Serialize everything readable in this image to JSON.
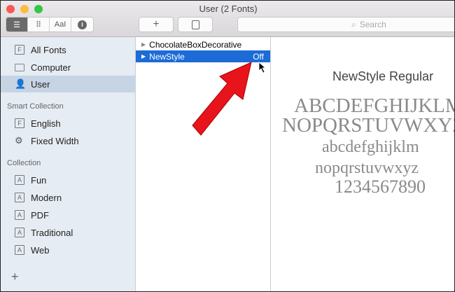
{
  "window": {
    "title": "User (2 Fonts)"
  },
  "toolbar": {
    "view_list": "list-view",
    "view_grid": "grid-view",
    "view_sample": "AaI",
    "info": "i",
    "add": "+",
    "search_placeholder": "Search"
  },
  "sidebar": {
    "items": [
      {
        "label": "All Fonts",
        "icon": "F"
      },
      {
        "label": "Computer"
      },
      {
        "label": "User"
      }
    ],
    "smart_header": "Smart Collection",
    "smart": [
      {
        "label": "English",
        "icon": "F"
      },
      {
        "label": "Fixed Width"
      }
    ],
    "collection_header": "Collection",
    "collections": [
      {
        "label": "Fun",
        "icon": "A"
      },
      {
        "label": "Modern",
        "icon": "A"
      },
      {
        "label": "PDF",
        "icon": "A"
      },
      {
        "label": "Traditional",
        "icon": "A"
      },
      {
        "label": "Web",
        "icon": "A"
      }
    ],
    "add": "+"
  },
  "fonts": [
    {
      "name": "ChocolateBoxDecorative",
      "status": ""
    },
    {
      "name": "NewStyle",
      "status": "Off"
    }
  ],
  "preview": {
    "title": "NewStyle Regular",
    "lines": [
      "ABCDEFGHIJKLM",
      "NOPQRSTUVWXYZ",
      "abcdefghijklm",
      "nopqrstuvwxyz",
      "1234567890"
    ]
  },
  "colors": {
    "selection": "#1c6bd6",
    "arrow": "#e8141b"
  }
}
